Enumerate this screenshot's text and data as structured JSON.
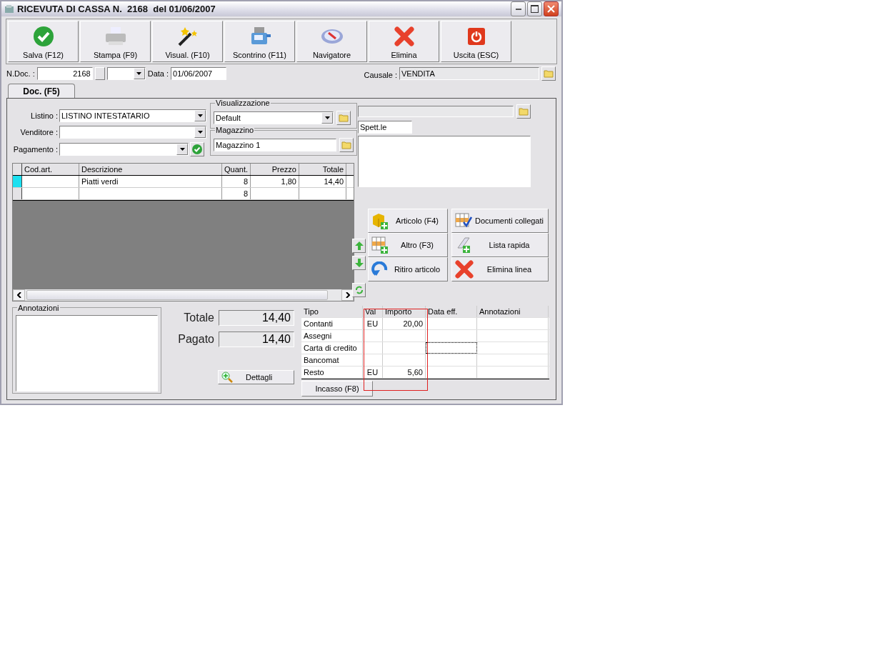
{
  "window": {
    "title": "RICEVUTA DI CASSA N.  2168  del 01/06/2007"
  },
  "toolbar": [
    {
      "label": "Salva (F12)",
      "kind": "check"
    },
    {
      "label": "Stampa (F9)",
      "kind": "printer"
    },
    {
      "label": "Visual. (F10)",
      "kind": "wand"
    },
    {
      "label": "Scontrino (F11)",
      "kind": "register"
    },
    {
      "label": "Navigatore",
      "kind": "compass"
    },
    {
      "label": "Elimina",
      "kind": "cross"
    },
    {
      "label": "Uscita (ESC)",
      "kind": "power"
    }
  ],
  "header": {
    "ndoc_label": "N.Doc. :",
    "ndoc": "2168",
    "data_label": "Data :",
    "data": "01/06/2007",
    "causale_label": "Causale :",
    "causale": "VENDITA"
  },
  "tabs": [
    {
      "label": "Doc. (F5)",
      "selected": true
    }
  ],
  "form": {
    "listino_label": "Listino :",
    "listino": "LISTINO INTESTATARIO",
    "venditore_label": "Venditore :",
    "pagamento_label": "Pagamento :",
    "visualizzazione_title": "Visualizzazione",
    "visualizzazione": "Default",
    "magazzino_title": "Magazzino",
    "magazzino": "Magazzino 1"
  },
  "grid": {
    "columns": [
      "Cod.art.",
      "Descrizione",
      "Quant.",
      "Prezzo",
      "Totale"
    ],
    "rows": [
      {
        "selected": true,
        "cells": [
          "",
          "Piatti verdi",
          "8",
          "1,80",
          "14,40"
        ]
      },
      {
        "selected": false,
        "cells": [
          "",
          "",
          "8",
          "",
          ""
        ]
      }
    ]
  },
  "customer": {
    "salutation": "Spett.le"
  },
  "actions": [
    {
      "label": "Articolo (F4)",
      "kind": "cube"
    },
    {
      "label": "Documenti collegati",
      "kind": "grid-check"
    },
    {
      "label": "Altro (F3)",
      "kind": "grid-plus"
    },
    {
      "label": "Lista rapida",
      "kind": "scroll"
    },
    {
      "label": "Ritiro articolo",
      "kind": "undo"
    },
    {
      "label": "Elimina linea",
      "kind": "cross"
    }
  ],
  "annotazioni_title": "Annotazioni",
  "totals": [
    {
      "label": "Totale",
      "value": "14,40"
    },
    {
      "label": "Pagato",
      "value": "14,40"
    }
  ],
  "dettagli_button": "Dettagli",
  "payments": {
    "columns": [
      "Tipo",
      "Val",
      "Importo",
      "Data eff.",
      "Annotazioni"
    ],
    "rows": [
      {
        "tipo": "Contanti",
        "val": "EU",
        "importo": "20,00",
        "focused": false
      },
      {
        "tipo": "Assegni",
        "val": "",
        "importo": "",
        "focused": false
      },
      {
        "tipo": "Carta di credito",
        "val": "",
        "importo": "",
        "focused": true
      },
      {
        "tipo": "Bancomat",
        "val": "",
        "importo": "",
        "focused": false
      },
      {
        "tipo": "Resto",
        "val": "EU",
        "importo": "5,60",
        "focused": false
      }
    ]
  },
  "incasso_button": "Incasso (F8)"
}
